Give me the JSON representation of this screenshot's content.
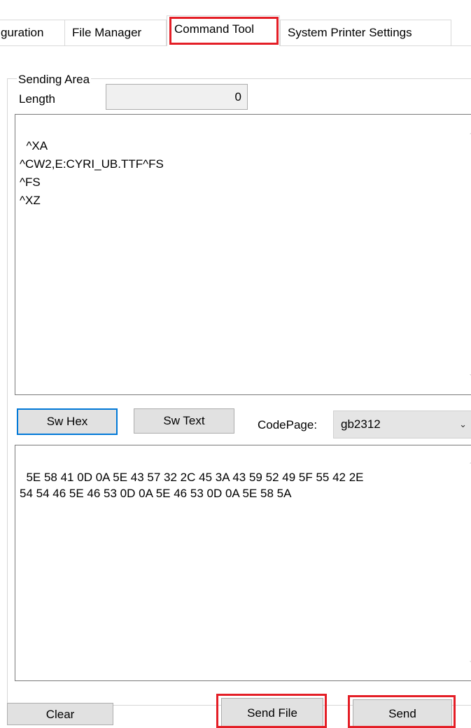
{
  "tabs": [
    {
      "label": "guration"
    },
    {
      "label": "File Manager"
    },
    {
      "label": "Command Tool"
    },
    {
      "label": "System Printer Settings"
    }
  ],
  "sending_area": {
    "title": "Sending Area",
    "length_label": "Length",
    "length_value": "0",
    "command_text": "^XA\n^CW2,E:CYRI_UB.TTF^FS\n^FS\n^XZ"
  },
  "buttons": {
    "sw_hex": "Sw Hex",
    "sw_text": "Sw Text",
    "clear": "Clear",
    "send_file": "Send File",
    "send": "Send"
  },
  "codepage": {
    "label": "CodePage:",
    "selected": "gb2312"
  },
  "hex_output": "5E 58 41 0D 0A 5E 43 57 32 2C 45 3A 43 59 52 49 5F 55 42 2E\n54 54 46 5E 46 53 0D 0A 5E 46 53 0D 0A 5E 58 5A",
  "colors": {
    "highlight": "#e41e26",
    "focus_border": "#0078d7"
  }
}
